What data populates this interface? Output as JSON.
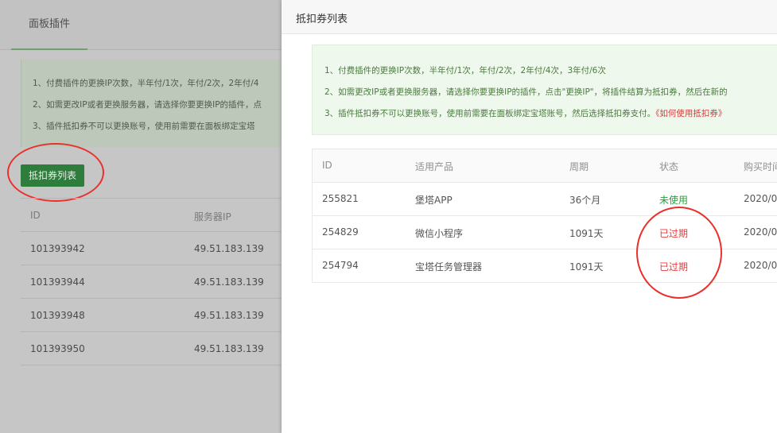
{
  "background_panel": {
    "tab_label": "面板插件",
    "notice_lines": [
      "1、付费插件的更换IP次数，半年付/1次，年付/2次，2年付/4",
      "2、如需更改IP或者更换服务器，请选择你要更换IP的插件，点",
      "3、插件抵扣券不可以更换账号，使用前需要在面板绑定宝塔"
    ],
    "voucher_list_button": "抵扣券列表",
    "table": {
      "headers": [
        "ID",
        "服务器IP"
      ],
      "rows": [
        [
          "101393942",
          "49.51.183.139"
        ],
        [
          "101393944",
          "49.51.183.139"
        ],
        [
          "101393948",
          "49.51.183.139"
        ],
        [
          "101393950",
          "49.51.183.139"
        ]
      ]
    }
  },
  "modal": {
    "title": "抵扣券列表",
    "notice": {
      "line1": "1、付费插件的更换IP次数，半年付/1次，年付/2次，2年付/4次，3年付/6次",
      "line2": "2、如需更改IP或者更换服务器，请选择你要更换IP的插件，点击\"更换IP\"，将插件结算为抵扣券，然后在新的",
      "line3": "3、插件抵扣券不可以更换账号，使用前需要在面板绑定宝塔账号，然后选择抵扣券支付。",
      "help_link": "《如何使用抵扣券》"
    },
    "table": {
      "headers": {
        "id": "ID",
        "product": "适用产品",
        "period": "周期",
        "status": "状态",
        "purchase_time": "购买时间"
      },
      "rows": [
        {
          "id": "255821",
          "product": "堡塔APP",
          "period": "36个月",
          "status": "未使用",
          "status_type": "unused",
          "purchase_time": "2020/0"
        },
        {
          "id": "254829",
          "product": "微信小程序",
          "period": "1091天",
          "status": "已过期",
          "status_type": "expired",
          "purchase_time": "2020/0"
        },
        {
          "id": "254794",
          "product": "宝塔任务管理器",
          "period": "1091天",
          "status": "已过期",
          "status_type": "expired",
          "purchase_time": "2020/0"
        }
      ]
    }
  },
  "colors": {
    "accent_green": "#20a53a",
    "expired_red": "#e63d3d",
    "annotation_red": "#e8312c"
  }
}
